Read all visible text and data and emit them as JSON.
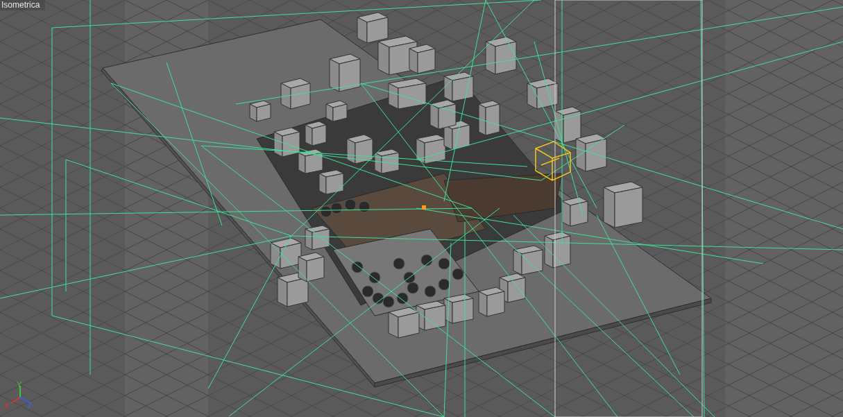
{
  "viewport": {
    "label": "Isometrica"
  },
  "axis_gizmo": {
    "labels": [
      "Y",
      "X",
      "Z"
    ]
  }
}
